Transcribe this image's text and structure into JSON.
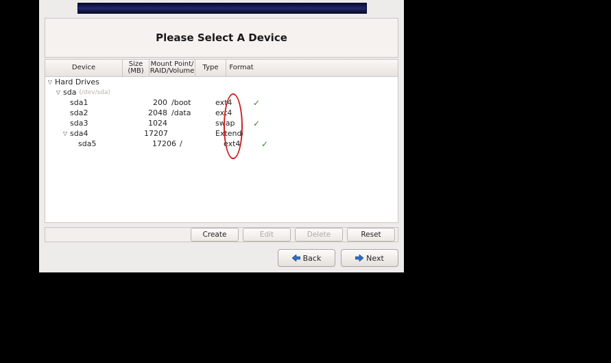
{
  "title": "Please Select A Device",
  "columns": {
    "device": "Device",
    "size": "Size\n(MB)",
    "mount": "Mount Point/\nRAID/Volume",
    "type": "Type",
    "format": "Format"
  },
  "tree": {
    "root_label": "Hard Drives",
    "disk": {
      "name": "sda",
      "path": "(/dev/sda)"
    },
    "partitions": [
      {
        "name": "sda1",
        "size": "200",
        "mount": "/boot",
        "type": "ext4",
        "format": true,
        "indent": 2
      },
      {
        "name": "sda2",
        "size": "2048",
        "mount": "/data",
        "type": "ext4",
        "format": false,
        "indent": 2
      },
      {
        "name": "sda3",
        "size": "1024",
        "mount": "",
        "type": "swap",
        "format": true,
        "indent": 2
      },
      {
        "name": "sda4",
        "size": "17207",
        "mount": "",
        "type": "Extended",
        "format": false,
        "indent": 2,
        "toggle": true
      },
      {
        "name": "sda5",
        "size": "17206",
        "mount": "/",
        "type": "ext4",
        "format": true,
        "indent": 3
      }
    ]
  },
  "buttons": {
    "create": "Create",
    "edit": "Edit",
    "delete": "Delete",
    "reset": "Reset"
  },
  "nav": {
    "back": "Back",
    "next": "Next"
  },
  "checkmark": "✓",
  "colors": {
    "annotation_red": "#cc1f1f",
    "check_green": "#3c7d3c",
    "banner_navy": "#1f2a6a"
  }
}
